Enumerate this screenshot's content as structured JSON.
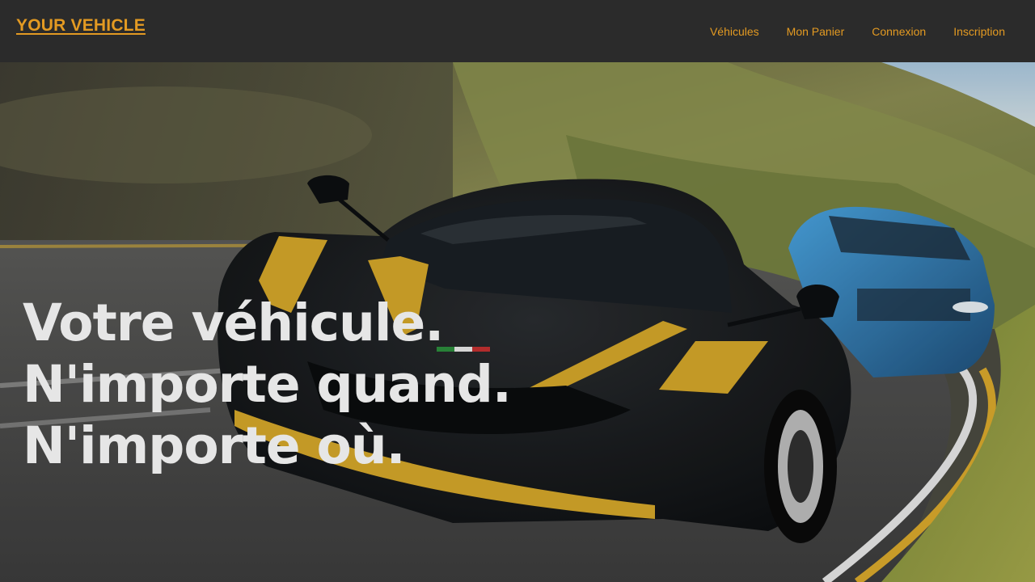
{
  "navbar": {
    "brand": "YOUR VEHICLE",
    "links": [
      {
        "label": "Véhicules"
      },
      {
        "label": "Mon Panier"
      },
      {
        "label": "Connexion"
      },
      {
        "label": "Inscription"
      }
    ]
  },
  "hero": {
    "lines": [
      "Votre véhicule.",
      "N'importe quand.",
      "N'importe où."
    ],
    "image": "sports-car-on-road-image"
  },
  "colors": {
    "accent": "#e39a22",
    "navbar_bg": "#2b2b2b",
    "hero_text": "#e6e6e6"
  }
}
